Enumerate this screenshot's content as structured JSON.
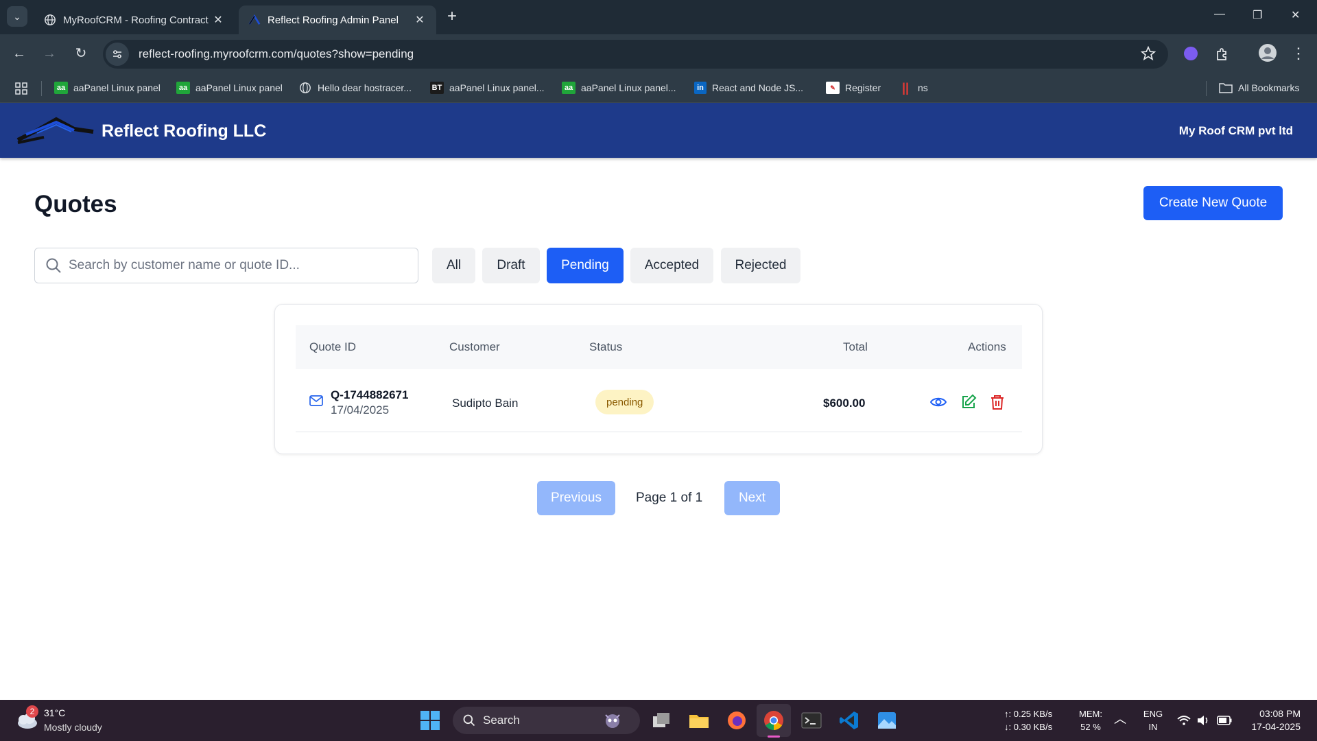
{
  "browser": {
    "tabs": [
      {
        "title": "MyRoofCRM - Roofing Contract",
        "active": false
      },
      {
        "title": "Reflect Roofing Admin Panel",
        "active": true
      }
    ],
    "url": "reflect-roofing.myroofcrm.com/quotes?show=pending",
    "bookmarks": [
      {
        "label": "aaPanel Linux panel",
        "icon": "aapanel-icon"
      },
      {
        "label": "aaPanel Linux panel",
        "icon": "aapanel-icon"
      },
      {
        "label": "Hello dear hostracer...",
        "icon": "globe-icon"
      },
      {
        "label": "aaPanel Linux panel...",
        "icon": "bt-icon"
      },
      {
        "label": "aaPanel Linux panel...",
        "icon": "aapanel-icon"
      },
      {
        "label": "React and Node JS...",
        "icon": "linkedin-icon"
      },
      {
        "label": "Register",
        "icon": "register-icon"
      },
      {
        "label": "ns",
        "icon": "ns-icon"
      }
    ],
    "all_bookmarks": "All Bookmarks"
  },
  "header": {
    "brand": "Reflect Roofing LLC",
    "company": "My Roof CRM pvt ltd",
    "color": "#1e3a8a"
  },
  "page": {
    "title": "Quotes",
    "create_label": "Create New Quote"
  },
  "search": {
    "placeholder": "Search by customer name or quote ID..."
  },
  "filters": [
    {
      "label": "All",
      "active": false
    },
    {
      "label": "Draft",
      "active": false
    },
    {
      "label": "Pending",
      "active": true
    },
    {
      "label": "Accepted",
      "active": false
    },
    {
      "label": "Rejected",
      "active": false
    }
  ],
  "table": {
    "columns": [
      "Quote ID",
      "Customer",
      "Status",
      "Total",
      "Actions"
    ],
    "rows": [
      {
        "id": "Q-1744882671",
        "date": "17/04/2025",
        "customer": "Sudipto Bain",
        "status": "pending",
        "total": "$600.00"
      }
    ]
  },
  "pagination": {
    "previous": "Previous",
    "page_label": "Page 1 of 1",
    "next": "Next"
  },
  "taskbar": {
    "weather_badge": "2",
    "temp": "31°C",
    "condition": "Mostly cloudy",
    "search_label": "Search",
    "net_up": "↑: 0.25 KB/s",
    "net_down": "↓: 0.30 KB/s",
    "mem_label": "MEM:",
    "mem_value": "52 %",
    "lang": "ENG",
    "region": "IN",
    "time": "03:08 PM",
    "date": "17-04-2025"
  },
  "colors": {
    "primary": "#1d5ef5",
    "primary_disabled": "#93b7fb",
    "badge_bg": "#fdf3c4",
    "view": "#1d5ef5",
    "edit": "#16a34a",
    "delete": "#dc2626"
  }
}
